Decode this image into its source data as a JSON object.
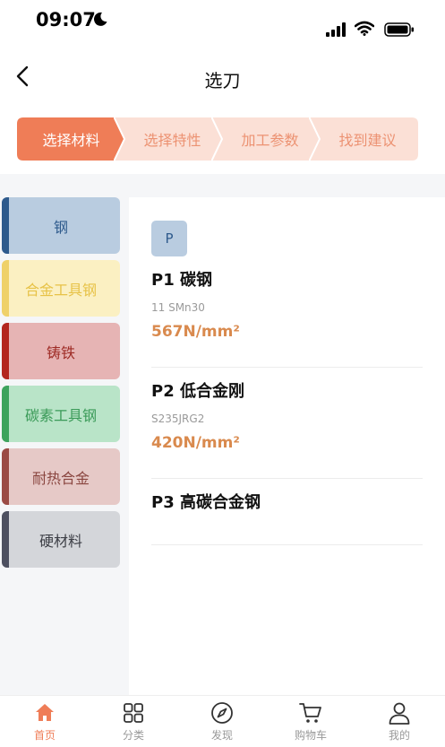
{
  "status_bar": {
    "time": "09:07"
  },
  "nav": {
    "title": "选刀"
  },
  "steps": [
    {
      "label": "选择材料",
      "active": true
    },
    {
      "label": "选择特性",
      "active": false
    },
    {
      "label": "加工参数",
      "active": false
    },
    {
      "label": "找到建议",
      "active": false
    }
  ],
  "categories": [
    {
      "label": "钢",
      "bg": "#b9cce0",
      "bar": "#2e5a8c",
      "text": "#2e5a8c"
    },
    {
      "label": "合金工具钢",
      "bg": "#fbf0c2",
      "bar": "#efd16a",
      "text": "#e7c247"
    },
    {
      "label": "铸铁",
      "bg": "#e6b4b4",
      "bar": "#b3261e",
      "text": "#9e2b25"
    },
    {
      "label": "碳素工具钢",
      "bg": "#b9e4c8",
      "bar": "#3da35d",
      "text": "#3a9a58"
    },
    {
      "label": "耐热合金",
      "bg": "#e6c9c7",
      "bar": "#9a4a44",
      "text": "#8a4640"
    },
    {
      "label": "硬材料",
      "bg": "#d4d6da",
      "bar": "#4d5060",
      "text": "#3d3f46"
    }
  ],
  "panel": {
    "badge": "P",
    "items": [
      {
        "title": "P1 碳钢",
        "sub": "11 SMn30",
        "value": "567N/mm²"
      },
      {
        "title": "P2 低合金刚",
        "sub": "S235JRG2",
        "value": "420N/mm²"
      },
      {
        "title": "P3 高碳合金钢",
        "sub": "",
        "value": ""
      }
    ]
  },
  "tabs": [
    {
      "label": "首页",
      "icon": "home-icon",
      "active": true
    },
    {
      "label": "分类",
      "icon": "grid-icon",
      "active": false
    },
    {
      "label": "发现",
      "icon": "compass-icon",
      "active": false
    },
    {
      "label": "购物车",
      "icon": "cart-icon",
      "active": false
    },
    {
      "label": "我的",
      "icon": "user-icon",
      "active": false
    }
  ],
  "colors": {
    "accent": "#ef7d57",
    "step_inactive": "#fbe0d6",
    "step_inactive_text": "#ec9272"
  }
}
